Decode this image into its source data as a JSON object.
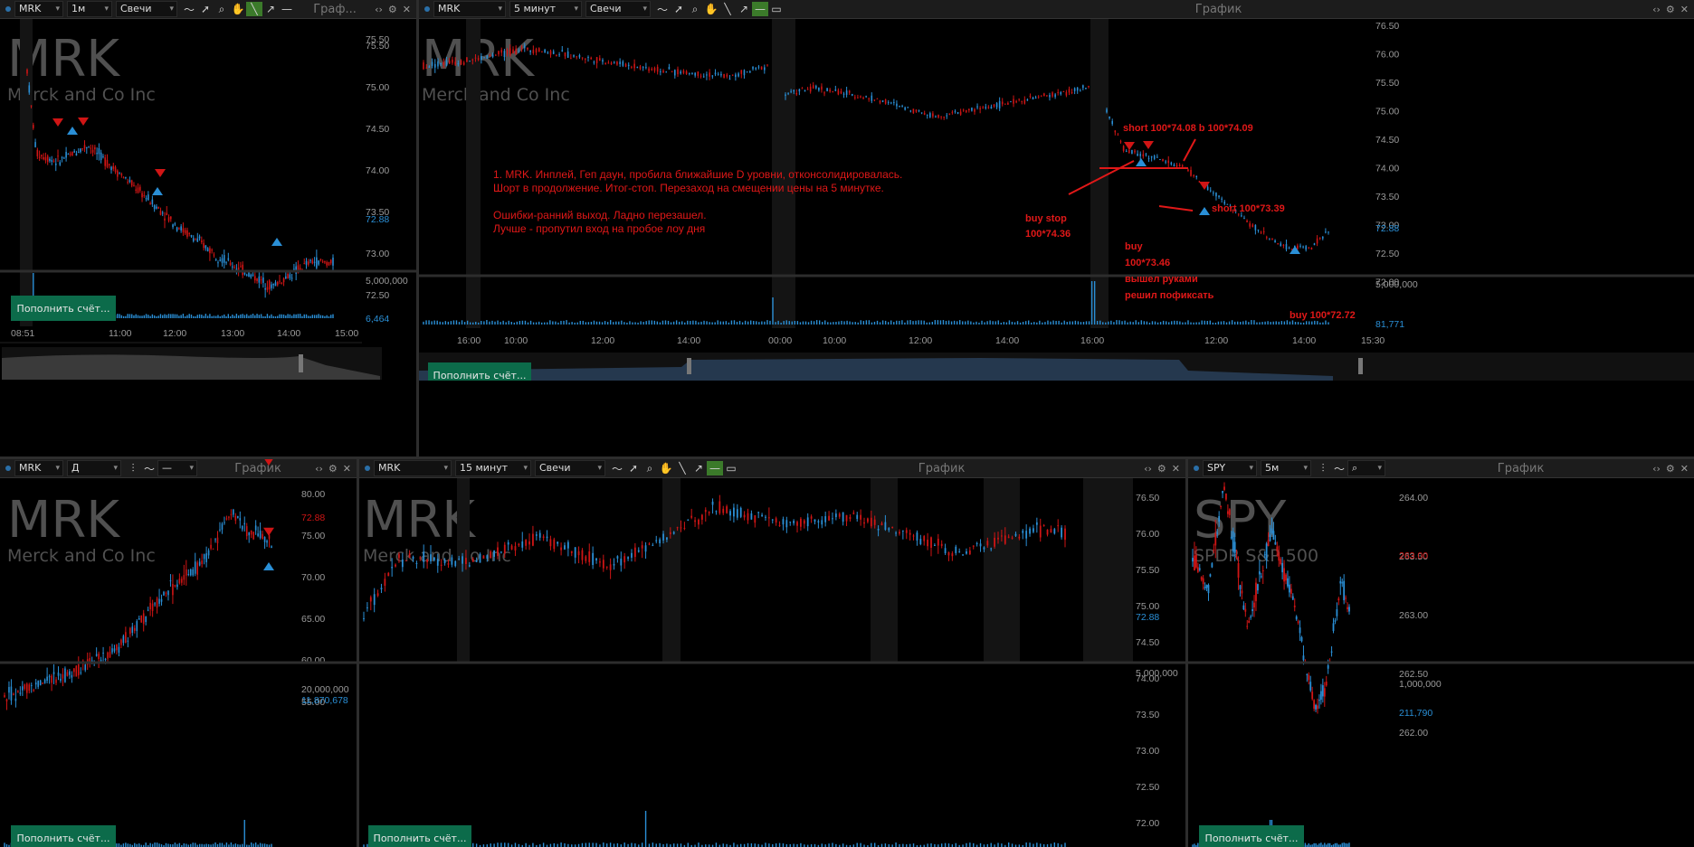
{
  "common": {
    "chart_title": "График",
    "fund_button": "Пополнить счёт...",
    "company": "Merck and Co Inc"
  },
  "p1": {
    "symbol": "MRK",
    "interval": "1м",
    "type": "Свечи",
    "title": "Граф...",
    "y_labels": [
      "75.50",
      "75.00",
      "74.50",
      "74.00",
      "73.50",
      "73.00",
      "72.50"
    ],
    "last": "72.88",
    "vol_max": "5,000,000",
    "vol_last": "6,464",
    "x_labels": [
      "08:51",
      "11:00",
      "12:00",
      "13:00",
      "14:00",
      "15:00"
    ]
  },
  "p2": {
    "symbol": "MRK",
    "interval": "5 минут",
    "type": "Свечи",
    "y_labels": [
      "76.50",
      "76.00",
      "75.50",
      "75.00",
      "74.50",
      "74.00",
      "73.50",
      "73.00",
      "72.50",
      "72.00"
    ],
    "last": "72.88",
    "vol_max": "5,000,000",
    "vol_last": "81,771",
    "x_labels": [
      "16:00",
      "10:00",
      "12:00",
      "14:00",
      "00:00",
      "10:00",
      "12:00",
      "14:00",
      "16:00",
      "12:00",
      "14:00",
      "15:30"
    ],
    "note": [
      "1. MRK. Инплей, Геп даун, пробила ближайшие D уровни, отконсолидировалась.",
      "Шорт в продолжение.  Итог-стоп. Перезаход на смещении цены на 5 минутке.",
      "",
      "Ошибки-ранний выход. Ладно перезашел.",
      "Лучше - пропутил вход на пробое лоу дня"
    ],
    "ann_short1": "short 100*74.08 b 100*74.09",
    "ann_buystop1": "buy stop",
    "ann_buystop2": "100*74.36",
    "ann_short2": "short 100*73.39",
    "ann_buy1": "buy",
    "ann_buy2": "100*73.46",
    "ann_buy3": "вышел руками",
    "ann_buy4": "решил пофиксать",
    "ann_buy5": "buy 100*72.72"
  },
  "p3": {
    "symbol": "MRK",
    "interval": "Д",
    "title": "График",
    "y_labels": [
      "80.00",
      "75.00",
      "70.00",
      "65.00",
      "60.00",
      "55.00"
    ],
    "last": "72.88",
    "vol_max": "20,000,000",
    "vol_last": "11,870,678"
  },
  "p4": {
    "symbol": "MRK",
    "interval": "15 минут",
    "type": "Свечи",
    "title": "График",
    "y_labels": [
      "76.50",
      "76.00",
      "75.50",
      "75.00",
      "74.50",
      "74.00",
      "73.50",
      "73.00",
      "72.50",
      "72.00"
    ],
    "last": "72.88",
    "vol_max": "5,000,000"
  },
  "p5": {
    "symbol": "SPY",
    "interval": "5м",
    "title": "График",
    "company": "SPDR S&P 500",
    "y_labels": [
      "264.00",
      "263.50",
      "263.00",
      "262.50",
      "262.00"
    ],
    "last": "263.00",
    "vol_max": "1,000,000",
    "vol_last": "211,790"
  },
  "colors": {
    "bg": "#000000",
    "up": "#2a8fd6",
    "down": "#d01515",
    "accent": "#0c6b4a",
    "annotation": "#e01818"
  }
}
